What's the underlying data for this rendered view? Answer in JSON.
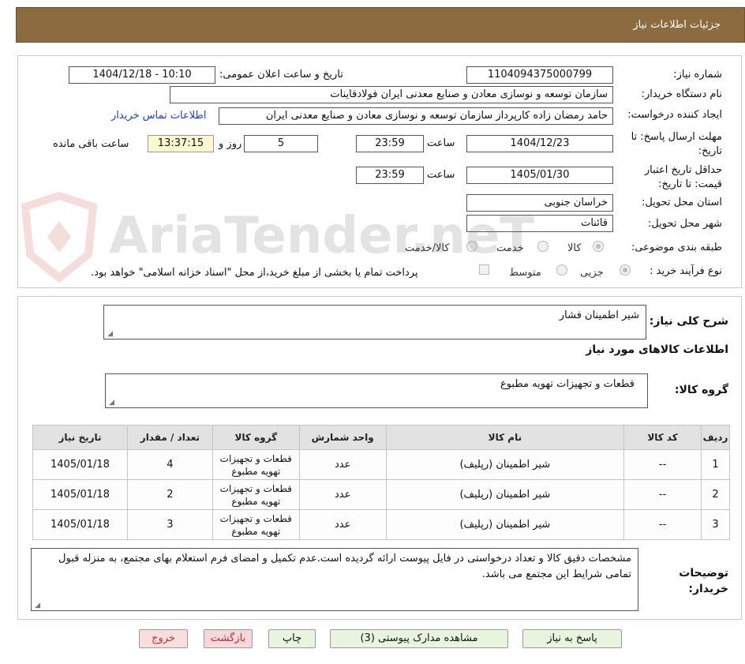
{
  "header": {
    "title": "جزئیات اطلاعات نیاز"
  },
  "form": {
    "need_number_label": "شماره نیاز:",
    "need_number": "1104094375000799",
    "announce_label": "تاریخ و ساعت اعلان عمومی:",
    "announce_value": "1404/12/18 - 10:10",
    "buyer_org_label": "نام دستگاه خریدار:",
    "buyer_org": "سازمان توسعه و نوسازی معادن و صنایع معدنی ایران فولادقاینات",
    "creator_label": "ایجاد کننده درخواست:",
    "creator": "حامد  رمضان زاده  کارپرداز  سازمان توسعه و نوسازی معادن و صنایع معدنی ایران",
    "contact_link": "اطلاعات تماس خریدار",
    "deadline_label": "مهلت ارسال پاسخ: تا تاریخ:",
    "deadline_date": "1404/12/23",
    "time_label": "ساعت",
    "deadline_time": "23:59",
    "days_value": "5",
    "days_label": "روز و",
    "remaining_time": "13:37:15",
    "remaining_label": "ساعت باقی مانده",
    "validity_label": "حداقل تاریخ اعتبار قیمت: تا تاریخ:",
    "validity_date": "1405/01/30",
    "validity_time": "23:59",
    "province_label": "استان محل تحویل:",
    "province": "خراسان جنوبی",
    "city_label": "شهر محل تحویل:",
    "city": "قائنات",
    "category_label": "طبقه بندی موضوعی:",
    "category_options": [
      "کالا",
      "خدمت",
      "کالا/خدمت"
    ],
    "process_label": "نوع فرآیند خرید :",
    "process_options": [
      "جزیی",
      "متوسط"
    ],
    "payment_note": "پرداخت تمام یا بخشی از مبلغ خرید،از محل \"اسناد خزانه اسلامی\" خواهد بود."
  },
  "details": {
    "summary_label": "شرح کلی نیاز:",
    "summary": "شیر اطمینان فشار",
    "goods_info_title": "اطلاعات کالاهای مورد نیاز",
    "goods_group_label": "گروه کالا:",
    "goods_group": "قطعات و تجهیزات تهویه مطبوع",
    "table": {
      "headers": [
        "ردیف",
        "کد کالا",
        "نام کالا",
        "واحد شمارش",
        "گروه کالا",
        "تعداد / مقدار",
        "تاریخ نیاز"
      ],
      "rows": [
        [
          "1",
          "--",
          "شیر اطمینان (رپلیف)",
          "عدد",
          "قطعات و تجهیزات تهویه مطبوع",
          "4",
          "1405/01/18"
        ],
        [
          "2",
          "--",
          "شیر اطمینان (رپلیف)",
          "عدد",
          "قطعات و تجهیزات تهویه مطبوع",
          "2",
          "1405/01/18"
        ],
        [
          "3",
          "--",
          "شیر اطمینان (رپلیف)",
          "عدد",
          "قطعات و تجهیزات تهویه مطبوع",
          "3",
          "1405/01/18"
        ]
      ]
    },
    "buyer_notes_label": "توضیحات خریدار:",
    "buyer_notes": "مشخصات دقیق کالا و تعداد درخواستی در فایل پیوست ارائه گردیده است.عدم تکمیل و امضای فرم استعلام بهای مجتمع، به منزله قبول تمامی شرایط این مجتمع می باشد."
  },
  "buttons": {
    "reply": "پاسخ به نیاز",
    "attachments": "مشاهده مدارک پیوستی (3)",
    "print": "چاپ",
    "back": "بازگشت",
    "exit": "خروج"
  },
  "watermark": {
    "text": "AriaTender.neT"
  }
}
